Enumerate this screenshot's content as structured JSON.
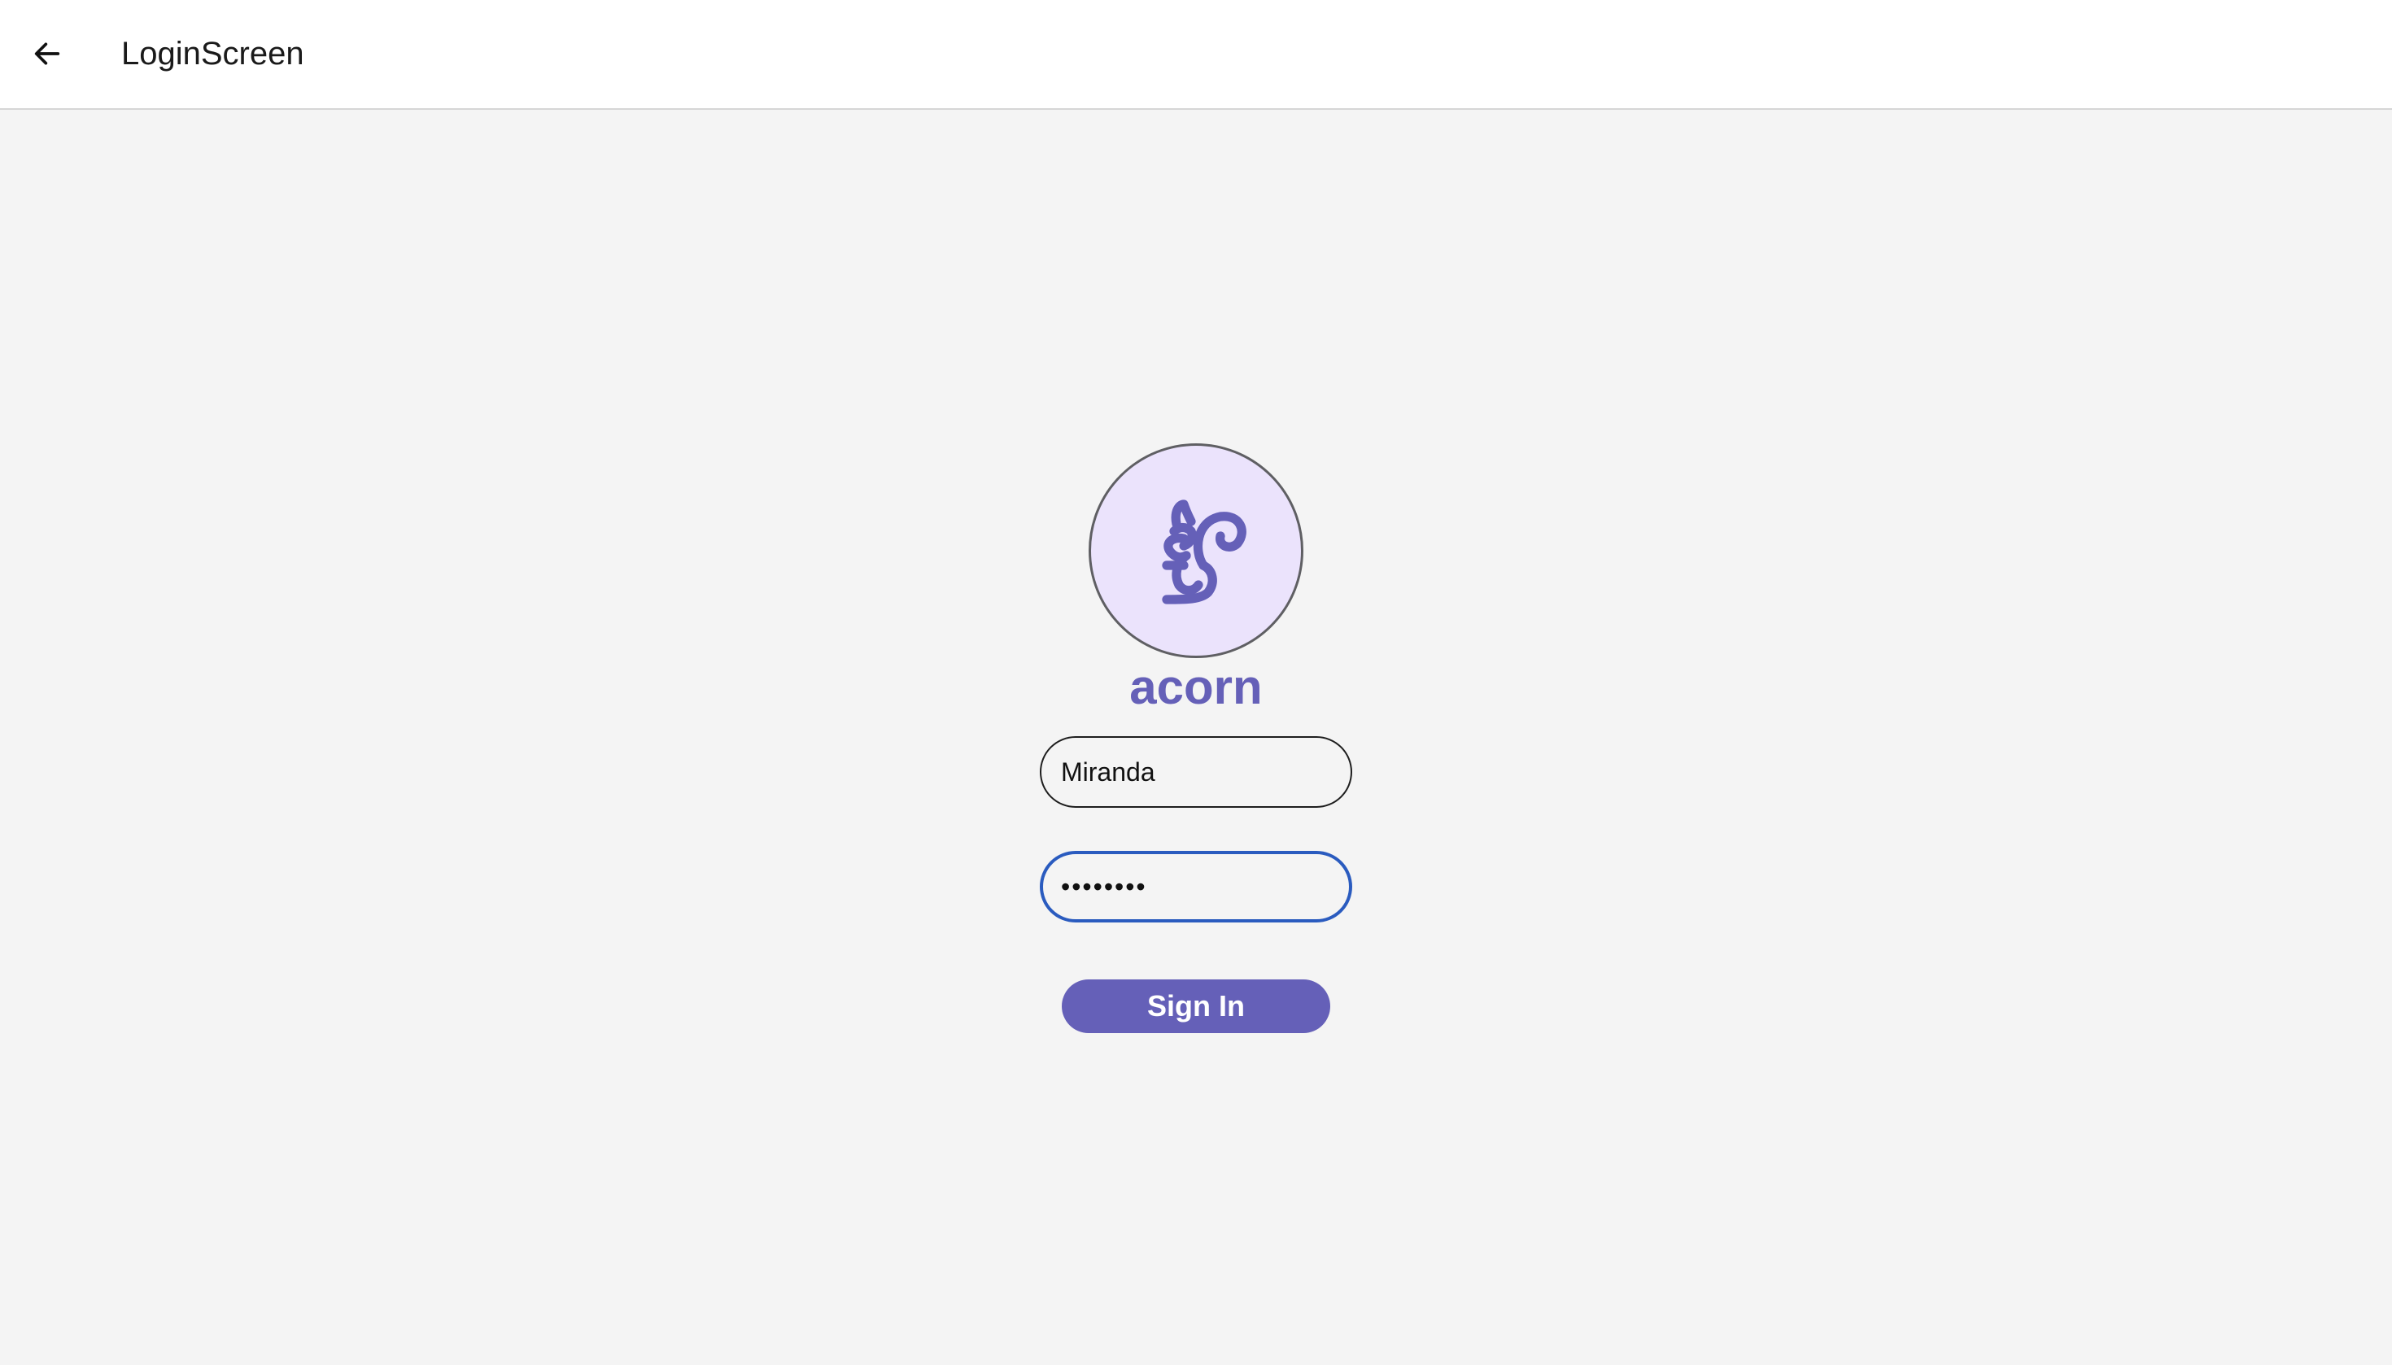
{
  "header": {
    "title": "LoginScreen",
    "back_icon": "arrow-left-icon"
  },
  "brand": {
    "logo_icon": "squirrel-icon",
    "name": "acorn",
    "color": "#6560b8",
    "logo_background": "#ebe3fc"
  },
  "form": {
    "username_value": "Miranda",
    "password_value": "••••••••",
    "focused_field": "password",
    "focus_color": "#2a5bbf"
  },
  "actions": {
    "sign_in_label": "Sign In"
  }
}
